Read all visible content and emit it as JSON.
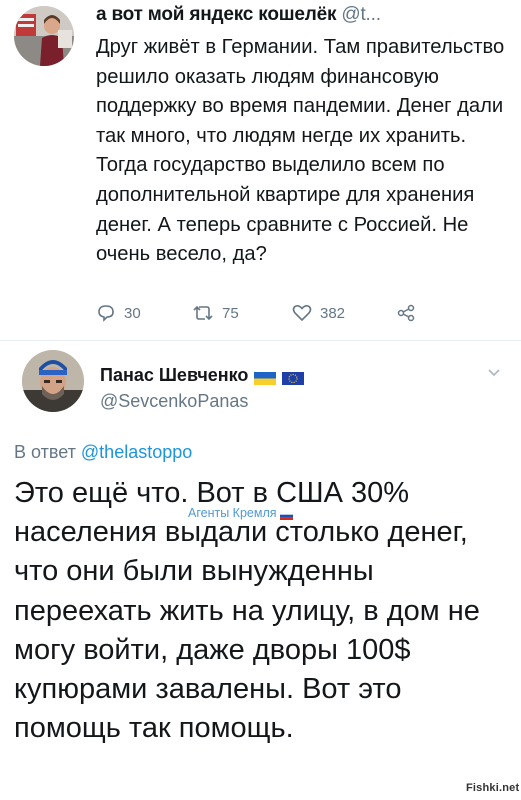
{
  "tweet": {
    "author_line": "а вот мой яндекс кошелёк",
    "handle_truncated": "@t...",
    "text": "Друг живёт в Германии. Там правительство решило оказать людям финансовую поддержку во время пандемии. Денег дали так много, что людям негде их хранить. Тогда государство выделило всем по дополнительной квартире для хранения денег. А теперь сравните с Россией. Не очень весело, да?",
    "replies": "30",
    "retweets": "75",
    "likes": "382"
  },
  "reply": {
    "author_name": "Панас Шевченко",
    "handle": "@SevcenkoPanas",
    "reply_prefix": "В ответ",
    "reply_to": "@thelastoppo",
    "text": "Это ещё что. Вот в США 30% населения выдали столько денег, что они были вынужденны переехать жить на улицу, в дом не могу войти, даже дворы 100$ купюрами завалены. Вот это помощь так помощь.",
    "stamp": "Агенты Кремля"
  },
  "watermark": "Fishki.net",
  "colors": {
    "text": "#14171a",
    "muted": "#657786",
    "link": "#1b95e0",
    "stamp": "#4f9ad6"
  }
}
